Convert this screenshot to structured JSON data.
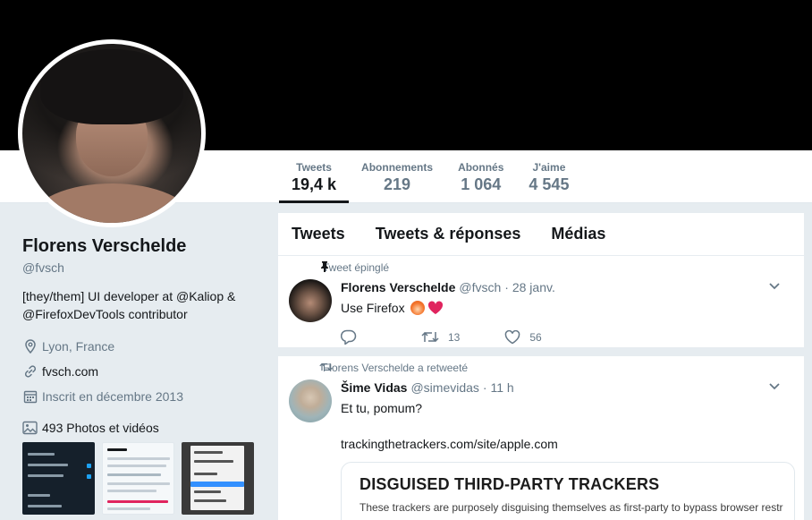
{
  "profile": {
    "name": "Florens Verschelde",
    "handle": "@fvsch",
    "bio": "[they/them] UI developer at @Kaliop & @FirefoxDevTools contributor",
    "location": "Lyon, France",
    "website": "fvsch.com",
    "joined": "Inscrit en décembre 2013",
    "media_count": "493 Photos et vidéos"
  },
  "stats": [
    {
      "label": "Tweets",
      "value": "19,4 k"
    },
    {
      "label": "Abonnements",
      "value": "219"
    },
    {
      "label": "Abonnés",
      "value": "1 064"
    },
    {
      "label": "J'aime",
      "value": "4 545"
    }
  ],
  "tabs": [
    "Tweets",
    "Tweets & réponses",
    "Médias"
  ],
  "tweets": [
    {
      "context": "Tweet épinglé",
      "name": "Florens Verschelde",
      "handle": "@fvsch",
      "time": "· 28 janv.",
      "text": "Use Firefox",
      "retweets": "13",
      "likes": "56"
    },
    {
      "context": "Florens Verschelde a retweeté",
      "name": "Šime Vidas",
      "handle": "@simevidas",
      "time": "· 11 h",
      "text": "Et tu, pomum?",
      "link": "trackingthetrackers.com/site/apple.com",
      "card_title": "DISGUISED THIRD-PARTY TRACKERS",
      "card_sub": "These trackers are purposely disguising themselves as first-party to bypass browser restr"
    }
  ],
  "colors": {
    "accent": "#1da1f2",
    "muted": "#657786",
    "background": "#e6ecf0"
  }
}
